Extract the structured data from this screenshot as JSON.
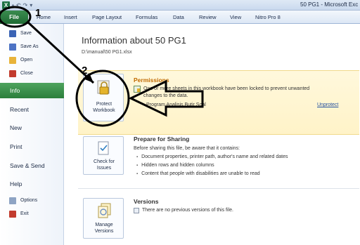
{
  "window": {
    "app_icon_glyph": "X",
    "title": "50 PG1 - Microsoft Exc"
  },
  "ribbon": {
    "file_tab": "File",
    "tabs": [
      "Home",
      "Insert",
      "Page Layout",
      "Formulas",
      "Data",
      "Review",
      "View",
      "Nitro Pro 8"
    ]
  },
  "backstage": {
    "commands": [
      {
        "label": "Save",
        "icon": "save-icon"
      },
      {
        "label": "Save As",
        "icon": "save-as-icon"
      },
      {
        "label": "Open",
        "icon": "open-folder-icon"
      },
      {
        "label": "Close",
        "icon": "close-file-icon"
      }
    ],
    "nav": [
      {
        "label": "Info",
        "active": true
      },
      {
        "label": "Recent",
        "active": false
      },
      {
        "label": "New",
        "active": false
      },
      {
        "label": "Print",
        "active": false
      },
      {
        "label": "Save & Send",
        "active": false
      },
      {
        "label": "Help",
        "active": false
      }
    ],
    "bottom_commands": [
      {
        "label": "Options",
        "icon": "options-icon"
      },
      {
        "label": "Exit",
        "icon": "exit-icon"
      }
    ]
  },
  "info": {
    "title": "Information about 50 PG1",
    "path": "D:\\manual\\50 PG1.xlsx",
    "permissions": {
      "button_line1": "Protect",
      "button_line2": "Workbook",
      "title": "Permissions",
      "text_line1": "One or more sheets in this workbook have been locked to prevent unwanted",
      "text_line2": "changes to the data.",
      "sheet_name": "Program Analisis Butir Soal",
      "unprotect_link": "Unprotect"
    },
    "prepare": {
      "button_line1": "Check for",
      "button_line2": "Issues",
      "title": "Prepare for Sharing",
      "intro": "Before sharing this file, be aware that it contains:",
      "bullets": [
        "Document properties, printer path, author's name and related dates",
        "Hidden rows and hidden columns",
        "Content that people with disabilities are unable to read"
      ]
    },
    "versions": {
      "button_line1": "Manage",
      "button_line2": "Versions",
      "title": "Versions",
      "text": "There are no previous versions of this file."
    }
  },
  "annotations": {
    "step1": "1",
    "step2": "2"
  },
  "colors": {
    "file_tab": "#2c7f3b",
    "active_nav": "#3d9450",
    "permissions_bg": "#fff6d5",
    "permissions_title": "#c06a00"
  }
}
